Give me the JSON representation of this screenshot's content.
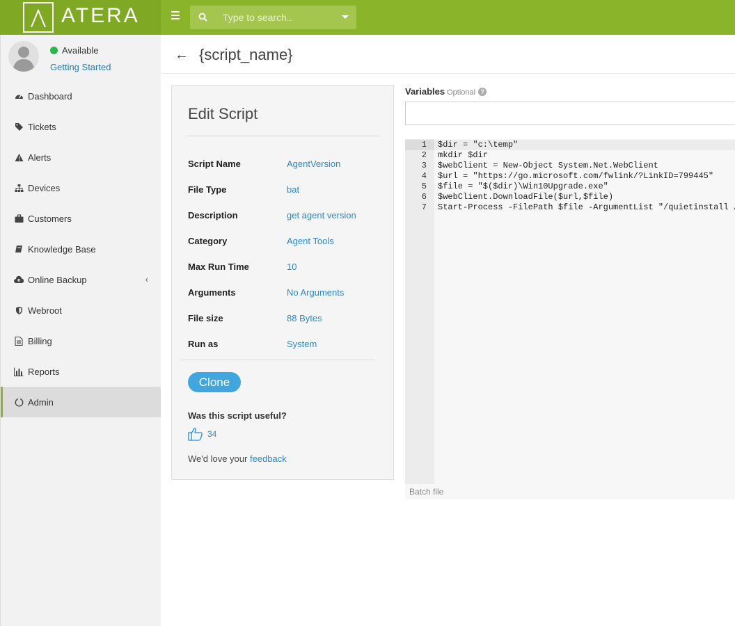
{
  "topbar": {
    "logo_text": "ATERA",
    "search_placeholder": "Type to search.."
  },
  "user": {
    "status": "Available",
    "status_color": "#2db54a",
    "getting_started": "Getting Started"
  },
  "sidebar": {
    "items": [
      {
        "label": "Dashboard",
        "icon": "dashboard-icon"
      },
      {
        "label": "Tickets",
        "icon": "tags-icon"
      },
      {
        "label": "Alerts",
        "icon": "warning-icon"
      },
      {
        "label": "Devices",
        "icon": "sitemap-icon"
      },
      {
        "label": "Customers",
        "icon": "briefcase-icon"
      },
      {
        "label": "Knowledge Base",
        "icon": "book-icon"
      },
      {
        "label": "Online Backup",
        "icon": "cloud-upload-icon"
      },
      {
        "label": "Webroot",
        "icon": "shield-icon"
      },
      {
        "label": "Billing",
        "icon": "document-icon"
      },
      {
        "label": "Reports",
        "icon": "bar-chart-icon"
      },
      {
        "label": "Admin",
        "icon": "circle-notch-icon",
        "active": true
      }
    ]
  },
  "page": {
    "title": "{script_name}"
  },
  "card": {
    "title": "Edit Script",
    "fields": [
      {
        "key": "Script Name",
        "value": "AgentVersion"
      },
      {
        "key": "File Type",
        "value": "bat"
      },
      {
        "key": "Description",
        "value": "get agent version"
      },
      {
        "key": "Category",
        "value": "Agent Tools"
      },
      {
        "key": "Max Run Time",
        "value": "10"
      },
      {
        "key": "Arguments",
        "value": "No Arguments"
      },
      {
        "key": "File size",
        "value": "88 Bytes"
      },
      {
        "key": "Run as",
        "value": "System"
      }
    ],
    "clone_label": "Clone",
    "useful_question": "Was this script useful?",
    "likes": "34",
    "feedback_prefix": "We'd love your",
    "feedback_link": "feedback"
  },
  "variables": {
    "label": "Variables",
    "optional": "Optional",
    "value": ""
  },
  "editor": {
    "lines": [
      "$dir = \"c:\\temp\"",
      "mkdir $dir",
      "$webClient = New-Object System.Net.WebClient",
      "$url = \"https://go.microsoft.com/fwlink/?LinkID=799445\"",
      "$file = \"$($dir)\\Win10Upgrade.exe\"",
      "$webClient.DownloadFile($url,$file)",
      "Start-Process -FilePath $file -ArgumentList \"/quietinstall /"
    ],
    "language": "Batch file"
  },
  "colors": {
    "brand_green": "#8ab52a",
    "link_blue": "#2a8ad0",
    "button_blue": "#41a6de"
  }
}
